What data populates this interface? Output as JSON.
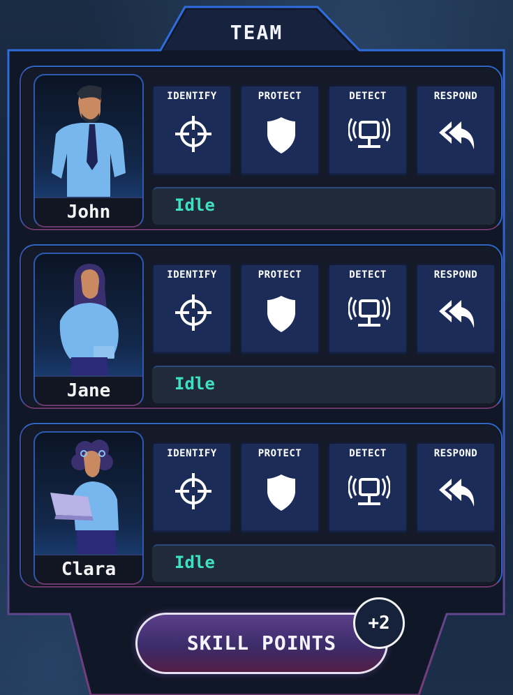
{
  "panel": {
    "title": "TEAM"
  },
  "skills": [
    "IDENTIFY",
    "PROTECT",
    "DETECT",
    "RESPOND"
  ],
  "members": [
    {
      "name": "John",
      "status": "Idle"
    },
    {
      "name": "Jane",
      "status": "Idle"
    },
    {
      "name": "Clara",
      "status": "Idle"
    }
  ],
  "skill_points": {
    "label": "SKILL POINTS",
    "badge": "+2"
  },
  "colors": {
    "status_text": "#3fe0c4",
    "frame_blue": "#2f66c4",
    "skill_tile": "#1c2c58"
  }
}
